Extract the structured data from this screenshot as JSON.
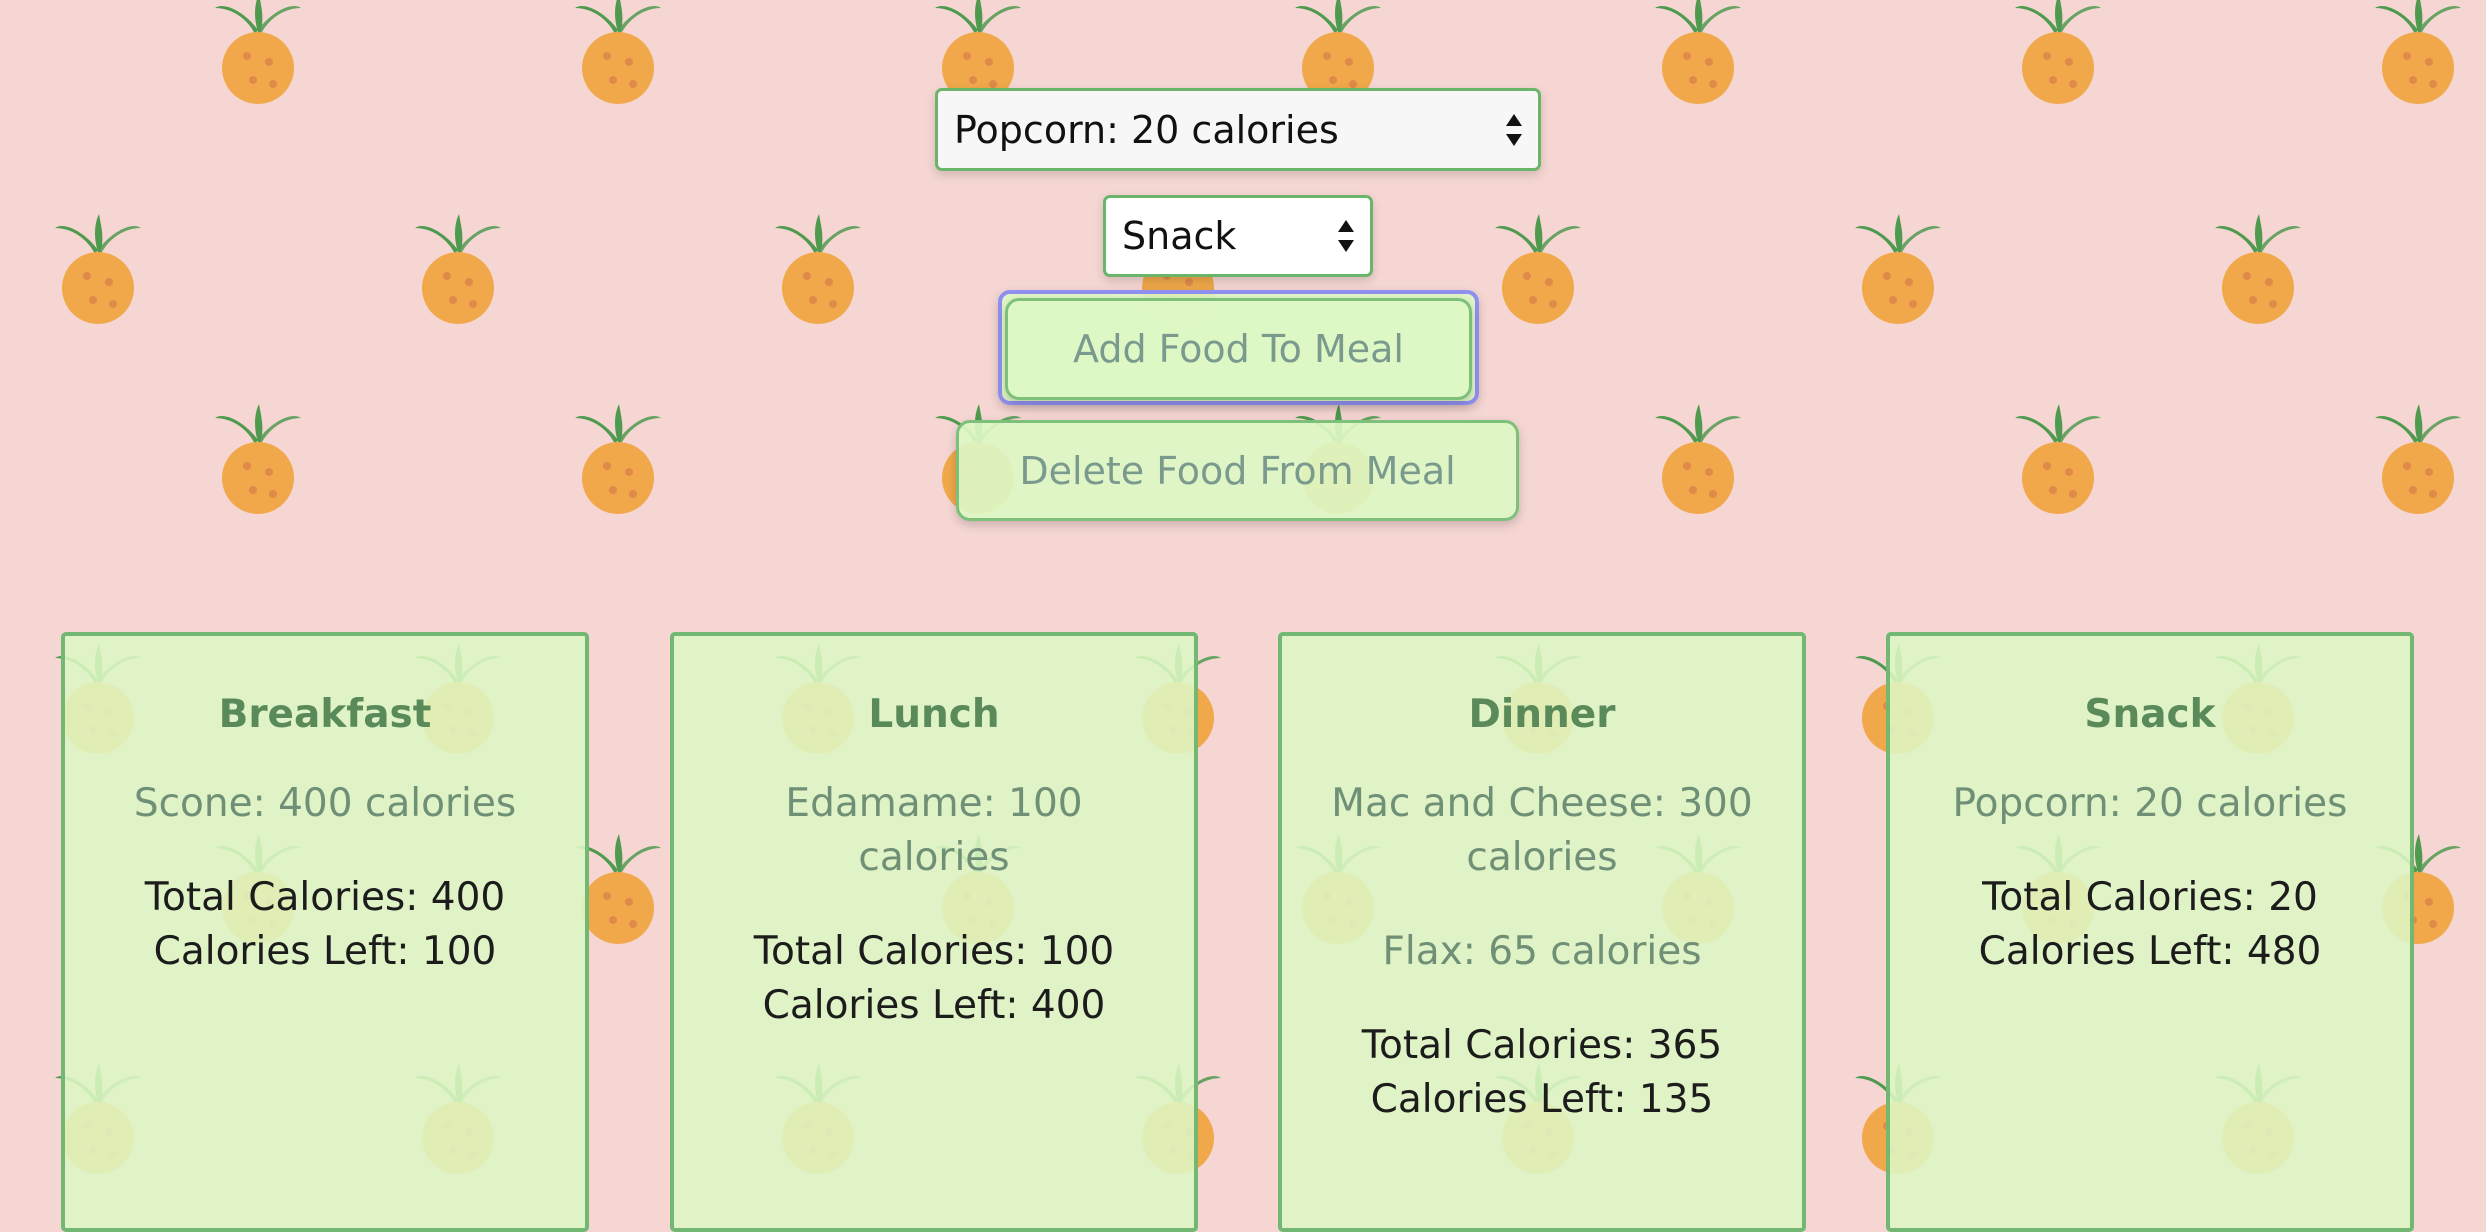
{
  "controls": {
    "food_select_value": "Popcorn: 20 calories",
    "meal_select_value": "Snack",
    "add_button_label": "Add Food To Meal",
    "delete_button_label": "Delete Food From Meal"
  },
  "meals": [
    {
      "title": "Breakfast",
      "foods": [
        "Scone: 400 calories"
      ],
      "total_label": "Total Calories: 400",
      "left_label": "Calories Left: 100"
    },
    {
      "title": "Lunch",
      "foods": [
        "Edamame: 100 calories"
      ],
      "total_label": "Total Calories: 100",
      "left_label": "Calories Left: 400"
    },
    {
      "title": "Dinner",
      "foods": [
        "Mac and Cheese: 300 calories",
        "Flax: 65 calories"
      ],
      "total_label": "Total Calories: 365",
      "left_label": "Calories Left: 135"
    },
    {
      "title": "Snack",
      "foods": [
        "Popcorn: 20 calories"
      ],
      "total_label": "Total Calories: 20",
      "left_label": "Calories Left: 480"
    }
  ],
  "colors": {
    "background": "#f5d6d3",
    "card_fill": "#ddf7c4",
    "card_border": "#72b872",
    "pineapple_body": "#f0a84a",
    "pineapple_leaf": "#4f9a4f"
  },
  "icons": {
    "background": "pineapple-icon",
    "select_arrows": "up-down-arrows-icon"
  }
}
